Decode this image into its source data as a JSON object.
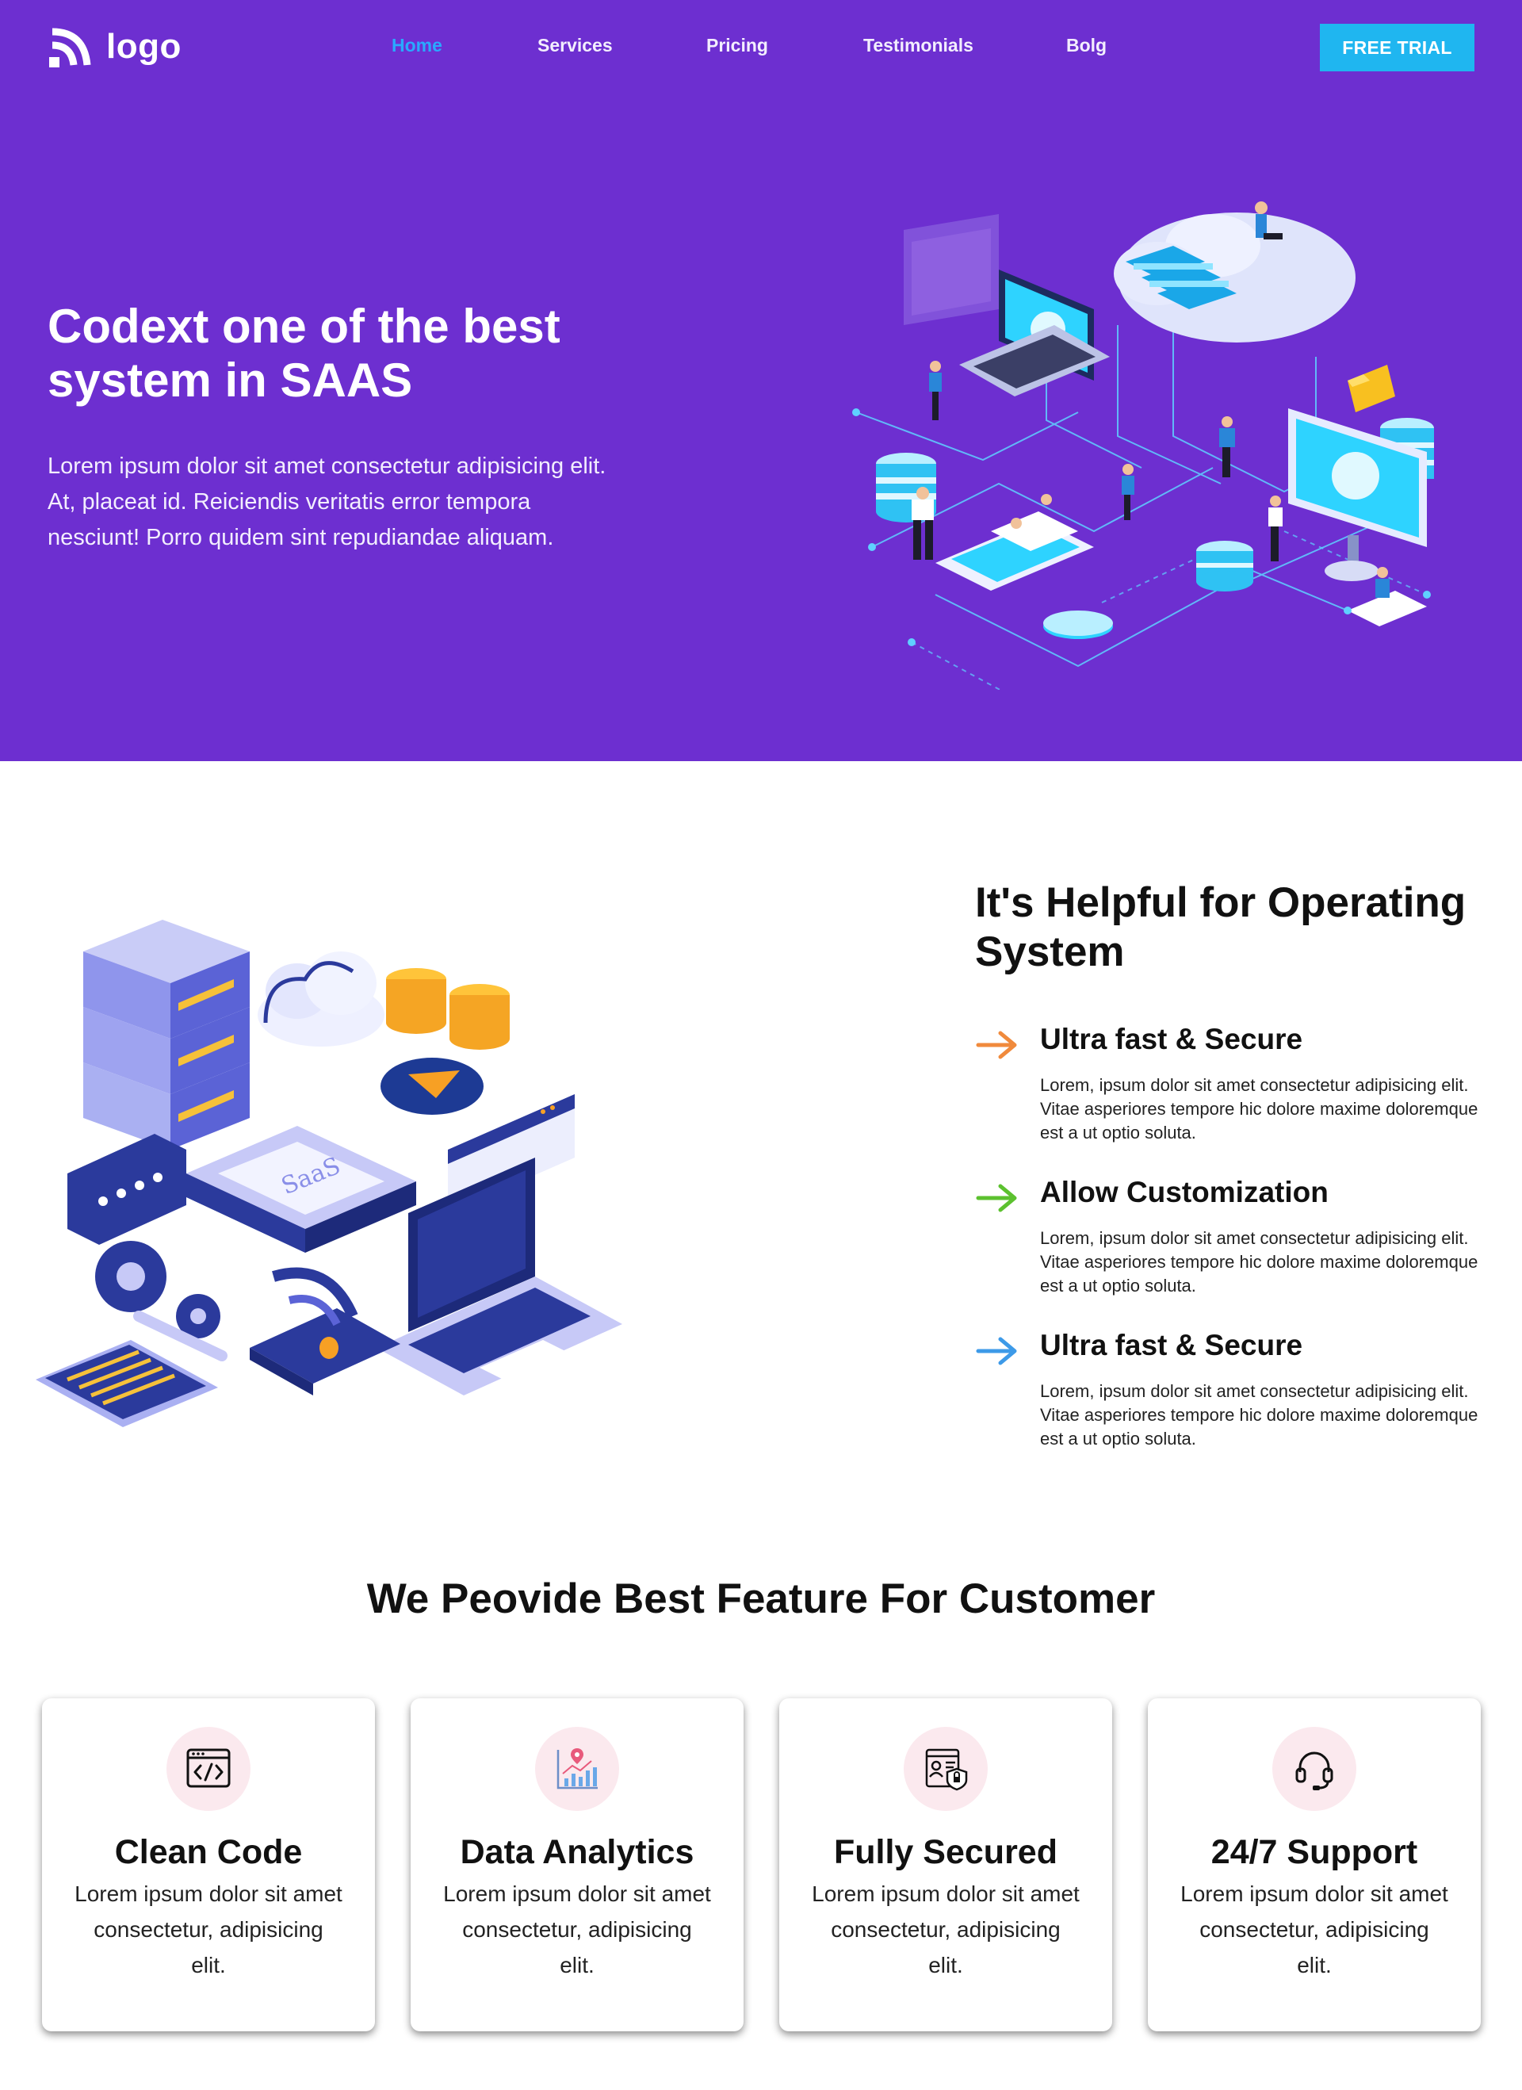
{
  "nav": {
    "logo_text": "logo",
    "links": [
      "Home",
      "Services",
      "Pricing",
      "Testimonials",
      "Bolg"
    ],
    "active_link": "Home",
    "cta_label": "FREE TRIAL",
    "colors": {
      "background": "#6d2fd0",
      "active": "#29a9ff",
      "cta": "#1fb6f0"
    }
  },
  "hero": {
    "title": "Codext one of the best system in SAAS",
    "text": "Lorem ipsum dolor sit amet consectetur adipisicing elit. At, placeat id. Reiciendis veritatis error tempora nesciunt! Porro quidem sint repudiandae aliquam."
  },
  "helpful": {
    "title": "It's Helpful for Operating System",
    "features": [
      {
        "title": "Ultra fast & Secure",
        "text": "Lorem, ipsum dolor sit amet consectetur adipisicing elit. Vitae asperiores tempore hic dolore maxime doloremque est a ut optio soluta.",
        "arrow_color": "#f08a3c",
        "icon": "arrow-right-icon"
      },
      {
        "title": "Allow Customization",
        "text": "Lorem, ipsum dolor sit amet consectetur adipisicing elit. Vitae asperiores tempore hic dolore maxime doloremque est a ut optio soluta.",
        "arrow_color": "#5cc12f",
        "icon": "arrow-right-icon"
      },
      {
        "title": "Ultra fast & Secure",
        "text": "Lorem, ipsum dolor sit amet consectetur adipisicing elit. Vitae asperiores tempore hic dolore maxime doloremque est a ut optio soluta.",
        "arrow_color": "#3d9ae8",
        "icon": "arrow-right-icon"
      }
    ]
  },
  "features": {
    "title": "We Peovide Best Feature For Customer",
    "cards": [
      {
        "title": "Clean Code",
        "text": "Lorem ipsum dolor sit amet consectetur, adipisicing elit.",
        "icon": "code-window-icon"
      },
      {
        "title": "Data Analytics",
        "text": "Lorem ipsum dolor sit amet consectetur, adipisicing elit.",
        "icon": "analytics-chart-icon"
      },
      {
        "title": "Fully Secured",
        "text": "Lorem ipsum dolor sit amet consectetur, adipisicing elit.",
        "icon": "secure-document-icon"
      },
      {
        "title": "24/7 Support",
        "text": "Lorem ipsum dolor sit amet consectetur, adipisicing elit.",
        "icon": "headset-icon"
      }
    ]
  }
}
